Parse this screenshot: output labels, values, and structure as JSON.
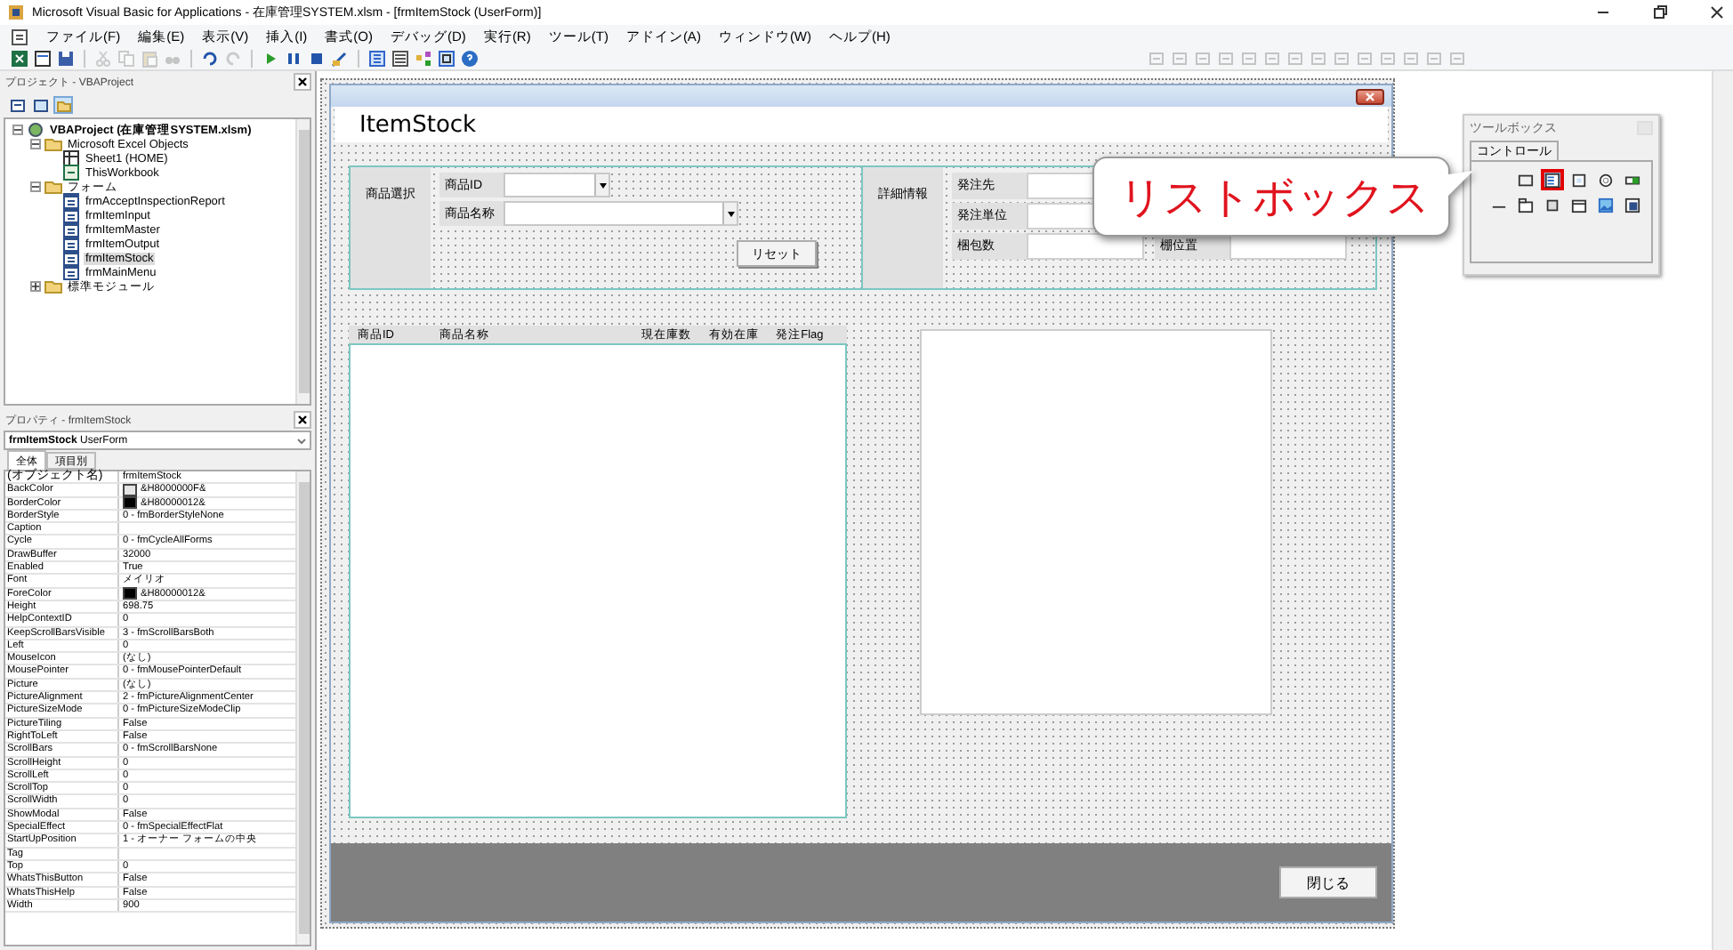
{
  "window": {
    "title": "Microsoft Visual Basic for Applications - 在庫管理SYSTEM.xlsm - [frmItemStock (UserForm)]"
  },
  "menu": [
    "ファイル(F)",
    "編集(E)",
    "表示(V)",
    "挿入(I)",
    "書式(O)",
    "デバッグ(D)",
    "実行(R)",
    "ツール(T)",
    "アドイン(A)",
    "ウィンドウ(W)",
    "ヘルプ(H)"
  ],
  "project_pane": {
    "title": "プロジェクト - VBAProject",
    "tree": [
      {
        "label": "VBAProject (在庫管理SYSTEM.xlsm)",
        "kind": "project",
        "expanded": true,
        "selected": false,
        "children": [
          {
            "label": "Microsoft Excel Objects",
            "kind": "folder",
            "expanded": true,
            "selected": false,
            "children": [
              {
                "label": "Sheet1 (HOME)",
                "kind": "sheet",
                "selected": false
              },
              {
                "label": "ThisWorkbook",
                "kind": "workbook",
                "selected": false
              }
            ]
          },
          {
            "label": "フォーム",
            "kind": "folder",
            "expanded": true,
            "selected": false,
            "children": [
              {
                "label": "frmAcceptInspectionReport",
                "kind": "form",
                "selected": false
              },
              {
                "label": "frmItemInput",
                "kind": "form",
                "selected": false
              },
              {
                "label": "frmItemMaster",
                "kind": "form",
                "selected": false
              },
              {
                "label": "frmItemOutput",
                "kind": "form",
                "selected": false
              },
              {
                "label": "frmItemStock",
                "kind": "form",
                "selected": true
              },
              {
                "label": "frmMainMenu",
                "kind": "form",
                "selected": false
              }
            ]
          },
          {
            "label": "標準モジュール",
            "kind": "folder",
            "expanded": false,
            "selected": false
          }
        ]
      }
    ]
  },
  "properties_pane": {
    "title": "プロパティ - frmItemStock",
    "object": {
      "name": "frmItemStock",
      "type": "UserForm"
    },
    "tabs": [
      {
        "label": "全体",
        "selected": true
      },
      {
        "label": "項目別",
        "selected": false
      }
    ],
    "rows": [
      {
        "name": "(オブジェクト名)",
        "value": "frmItemStock"
      },
      {
        "name": "BackColor",
        "value": "&H8000000F&",
        "color": "#e6e6e6"
      },
      {
        "name": "BorderColor",
        "value": "&H80000012&",
        "color": "#000000"
      },
      {
        "name": "BorderStyle",
        "value": "0 - fmBorderStyleNone"
      },
      {
        "name": "Caption",
        "value": ""
      },
      {
        "name": "Cycle",
        "value": "0 - fmCycleAllForms"
      },
      {
        "name": "DrawBuffer",
        "value": "32000"
      },
      {
        "name": "Enabled",
        "value": "True"
      },
      {
        "name": "Font",
        "value": "メイリオ"
      },
      {
        "name": "ForeColor",
        "value": "&H80000012&",
        "color": "#000000"
      },
      {
        "name": "Height",
        "value": "698.75"
      },
      {
        "name": "HelpContextID",
        "value": "0"
      },
      {
        "name": "KeepScrollBarsVisible",
        "value": "3 - fmScrollBarsBoth"
      },
      {
        "name": "Left",
        "value": "0"
      },
      {
        "name": "MouseIcon",
        "value": "(なし)"
      },
      {
        "name": "MousePointer",
        "value": "0 - fmMousePointerDefault"
      },
      {
        "name": "Picture",
        "value": "(なし)"
      },
      {
        "name": "PictureAlignment",
        "value": "2 - fmPictureAlignmentCenter"
      },
      {
        "name": "PictureSizeMode",
        "value": "0 - fmPictureSizeModeClip"
      },
      {
        "name": "PictureTiling",
        "value": "False"
      },
      {
        "name": "RightToLeft",
        "value": "False"
      },
      {
        "name": "ScrollBars",
        "value": "0 - fmScrollBarsNone"
      },
      {
        "name": "ScrollHeight",
        "value": "0"
      },
      {
        "name": "ScrollLeft",
        "value": "0"
      },
      {
        "name": "ScrollTop",
        "value": "0"
      },
      {
        "name": "ScrollWidth",
        "value": "0"
      },
      {
        "name": "ShowModal",
        "value": "False"
      },
      {
        "name": "SpecialEffect",
        "value": "0 - fmSpecialEffectFlat"
      },
      {
        "name": "StartUpPosition",
        "value": "1 - オーナー フォームの中央"
      },
      {
        "name": "Tag",
        "value": ""
      },
      {
        "name": "Top",
        "value": "0"
      },
      {
        "name": "WhatsThisButton",
        "value": "False"
      },
      {
        "name": "WhatsThisHelp",
        "value": "False"
      },
      {
        "name": "Width",
        "value": "900"
      }
    ]
  },
  "form": {
    "title": "ItemStock",
    "selection": {
      "label": "商品選択",
      "fields": [
        {
          "label": "商品ID",
          "kind": "short"
        },
        {
          "label": "商品名称",
          "kind": "long"
        }
      ],
      "button": "リセット"
    },
    "detail": {
      "label": "詳細情報",
      "fields": [
        {
          "label": "発注先"
        },
        {
          "label": "発注単位"
        },
        {
          "label": "梱包数"
        }
      ],
      "extra_field": {
        "label": "棚位置"
      }
    },
    "list_columns": [
      "商品ID",
      "商品名称",
      "現在庫数",
      "有効在庫",
      "発注Flag"
    ],
    "close_button": "閉じる"
  },
  "toolbox": {
    "title": "ツールボックス",
    "tab": "コントロール",
    "tools": [
      {
        "kind": "frame",
        "highlighted": false
      },
      {
        "kind": "listbox",
        "highlighted": true
      },
      {
        "kind": "checkbox",
        "highlighted": false
      },
      {
        "kind": "radio",
        "highlighted": false
      },
      {
        "kind": "toggle",
        "highlighted": false
      },
      {
        "kind": "line",
        "highlighted": false
      },
      {
        "kind": "tabstrip",
        "highlighted": false
      },
      {
        "kind": "button",
        "highlighted": false
      },
      {
        "kind": "multipage",
        "highlighted": false
      },
      {
        "kind": "image",
        "highlighted": false
      },
      {
        "kind": "refedit",
        "highlighted": false
      }
    ]
  },
  "callout": {
    "text": "リストボックス"
  }
}
